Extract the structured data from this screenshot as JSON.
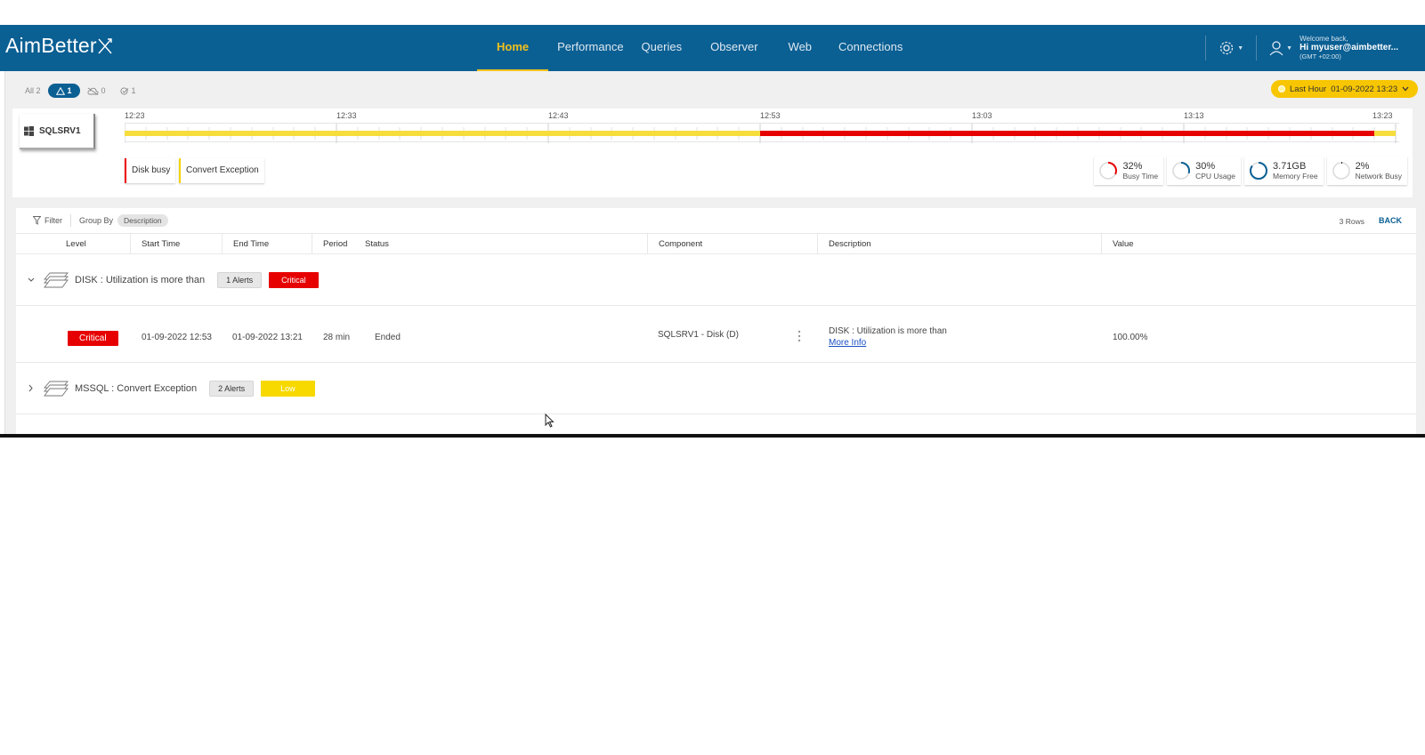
{
  "header": {
    "logo_text": "AimBetter",
    "nav": [
      "Home",
      "Performance",
      "Queries",
      "Observer",
      "Web",
      "Connections"
    ],
    "active_nav": "Home",
    "welcome_line": "Welcome back,",
    "user_line": "Hi myuser@aimbetter...",
    "tz_line": "(GMT +02:00)"
  },
  "filters": {
    "all_label": "All 2",
    "alerts_count": "1",
    "offline_count": "0",
    "resolved_count": "1"
  },
  "time_range": {
    "label": "Last Hour",
    "value": "01-09-2022 13:23"
  },
  "server": {
    "name": "SQLSRV1",
    "timeline_ticks": [
      "12:23",
      "12:33",
      "12:43",
      "12:53",
      "13:03",
      "13:13",
      "13:23"
    ],
    "event_tags": [
      "Disk busy",
      "Convert Exception"
    ],
    "colors": {
      "warning": "#f7dd3c",
      "critical": "#e60000"
    }
  },
  "metrics": [
    {
      "value": "32%",
      "label": "Busy Time",
      "fraction": 0.32,
      "color": "#e60000"
    },
    {
      "value": "30%",
      "label": "CPU Usage",
      "fraction": 0.3,
      "color": "#0a5f93"
    },
    {
      "value": "3.71GB",
      "label": "Memory Free",
      "fraction": 0.85,
      "color": "#0a5f93"
    },
    {
      "value": "2%",
      "label": "Network Busy",
      "fraction": 0.02,
      "color": "#333333"
    }
  ],
  "table": {
    "filter_label": "Filter",
    "group_by_label": "Group By",
    "group_by_value": "Description",
    "rows_count": "3 Rows",
    "back_label": "BACK",
    "columns": [
      "Level",
      "Start Time",
      "End Time",
      "Period",
      "Status",
      "Component",
      "Description",
      "Value"
    ],
    "groups": [
      {
        "title": "DISK : Utilization is more than",
        "alerts": "1 Alerts",
        "severity": "Critical",
        "expanded": true
      },
      {
        "title": "MSSQL : Convert Exception",
        "alerts": "2 Alerts",
        "severity": "Low",
        "expanded": false
      }
    ],
    "detail": {
      "level": "Critical",
      "start_time": "01-09-2022 12:53",
      "end_time": "01-09-2022 13:21",
      "period": "28 min",
      "status": "Ended",
      "component": "SQLSRV1 - Disk (D)",
      "description": "DISK : Utilization is more than",
      "more_info": "More Info",
      "value": "100.00%"
    }
  }
}
